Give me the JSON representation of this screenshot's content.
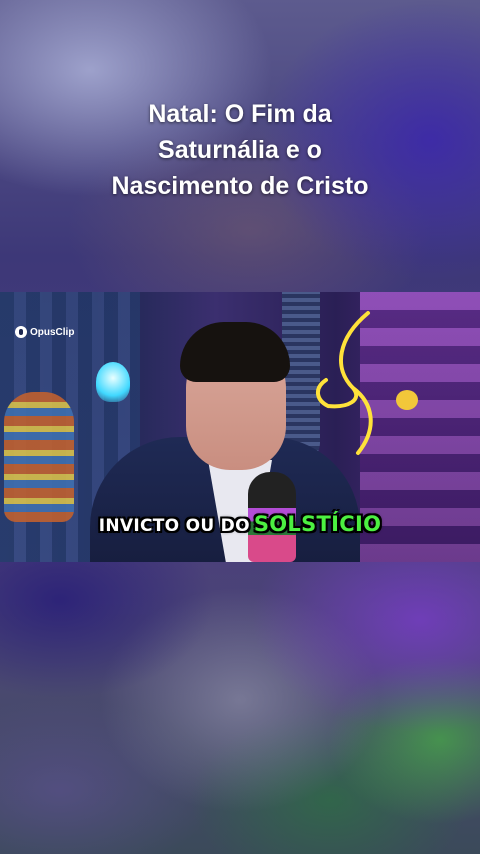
{
  "title": {
    "lines": [
      "Natal: O Fim da",
      "Saturnália e o",
      "Nascimento de Cristo"
    ]
  },
  "video": {
    "watermark_label": "OpusClip",
    "watermark_icon": "opusclip-logo-icon",
    "caption_white": "INVICTO OU DO",
    "caption_highlight": "SOLSTÍCIO",
    "caption_highlight_color": "#4cf041"
  }
}
